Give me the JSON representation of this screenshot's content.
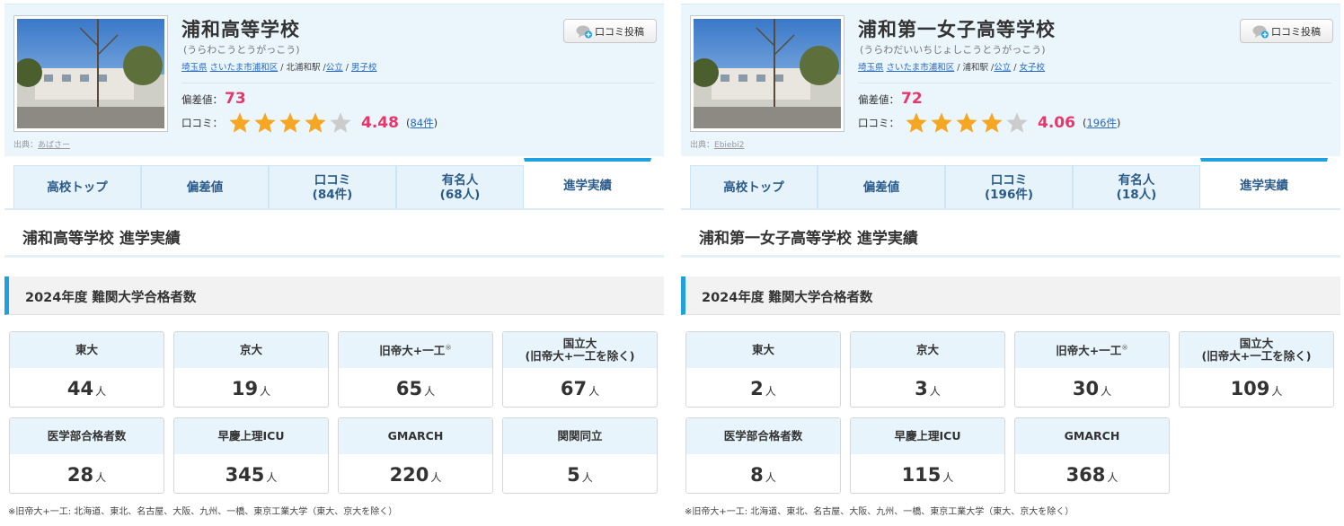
{
  "panels": [
    {
      "school_name": "浦和高等学校",
      "school_kana": "(うらわこうとうがっこう)",
      "prefecture": "埼玉県",
      "city": "さいたま市浦和区",
      "station": "/ 北浦和駅 /",
      "type": "公立",
      "sep": " / ",
      "gender": "男子校",
      "credit_label": "出典：",
      "credit_name": "あばさー",
      "post_button": "口コミ投稿",
      "hensachi_label": "偏差値：",
      "hensachi_value": "73",
      "review_label": "口コミ：",
      "review_stars": 4.48,
      "review_score": "4.48",
      "review_count_open": "(",
      "review_count": "84件",
      "review_count_close": ")",
      "tabs": [
        {
          "label": "高校トップ"
        },
        {
          "label": "偏差値"
        },
        {
          "label": "口コミ",
          "sub": "(84件)"
        },
        {
          "label": "有名人",
          "sub": "(68人)"
        },
        {
          "label": "進学実績"
        }
      ],
      "section_title": "浦和高等学校 進学実績",
      "year_title": "2024年度 難関大学合格者数",
      "cards": [
        {
          "label": "東大",
          "value": "44",
          "unit": "人"
        },
        {
          "label": "京大",
          "value": "19",
          "unit": "人"
        },
        {
          "label": "旧帝大+一工",
          "mark": "※",
          "value": "65",
          "unit": "人"
        },
        {
          "label": "国立大",
          "label2": "(旧帝大+一工を除く)",
          "value": "67",
          "unit": "人"
        },
        {
          "label": "医学部合格者数",
          "value": "28",
          "unit": "人"
        },
        {
          "label": "早慶上理ICU",
          "value": "345",
          "unit": "人"
        },
        {
          "label": "GMARCH",
          "value": "220",
          "unit": "人"
        },
        {
          "label": "関関同立",
          "value": "5",
          "unit": "人"
        }
      ],
      "note": "※旧帝大+一工: 北海道、東北、名古屋、大阪、九州、一橋、東京工業大学（東大、京大を除く）"
    },
    {
      "school_name": "浦和第一女子高等学校",
      "school_kana": "(うらわだいいちじょしこうとうがっこう)",
      "prefecture": "埼玉県",
      "city": "さいたま市浦和区",
      "station": "/ 浦和駅 /",
      "type": "公立",
      "sep": " / ",
      "gender": "女子校",
      "credit_label": "出典：",
      "credit_name": "Ebiebi2",
      "post_button": "口コミ投稿",
      "hensachi_label": "偏差値：",
      "hensachi_value": "72",
      "review_label": "口コミ：",
      "review_stars": 4.06,
      "review_score": "4.06",
      "review_count_open": "(",
      "review_count": "196件",
      "review_count_close": ")",
      "tabs": [
        {
          "label": "高校トップ"
        },
        {
          "label": "偏差値"
        },
        {
          "label": "口コミ",
          "sub": "(196件)"
        },
        {
          "label": "有名人",
          "sub": "(18人)"
        },
        {
          "label": "進学実績"
        }
      ],
      "section_title": "浦和第一女子高等学校 進学実績",
      "year_title": "2024年度 難関大学合格者数",
      "cards": [
        {
          "label": "東大",
          "value": "2",
          "unit": "人"
        },
        {
          "label": "京大",
          "value": "3",
          "unit": "人"
        },
        {
          "label": "旧帝大+一工",
          "mark": "※",
          "value": "30",
          "unit": "人"
        },
        {
          "label": "国立大",
          "label2": "(旧帝大+一工を除く)",
          "value": "109",
          "unit": "人"
        },
        {
          "label": "医学部合格者数",
          "value": "8",
          "unit": "人"
        },
        {
          "label": "早慶上理ICU",
          "value": "115",
          "unit": "人"
        },
        {
          "label": "GMARCH",
          "value": "368",
          "unit": "人"
        }
      ],
      "note": "※旧帝大+一工: 北海道、東北、名古屋、大阪、九州、一橋、東京工業大学（東大、京大を除く）"
    }
  ],
  "active_tab_index": 4,
  "colors": {
    "accent": "#1da1df",
    "highlight": "#e8366a",
    "link": "#2a6ac0",
    "star": "#f5a623",
    "star_empty": "#cccccc"
  },
  "icons": {
    "post": "comment-plus-icon",
    "star": "star-icon"
  }
}
